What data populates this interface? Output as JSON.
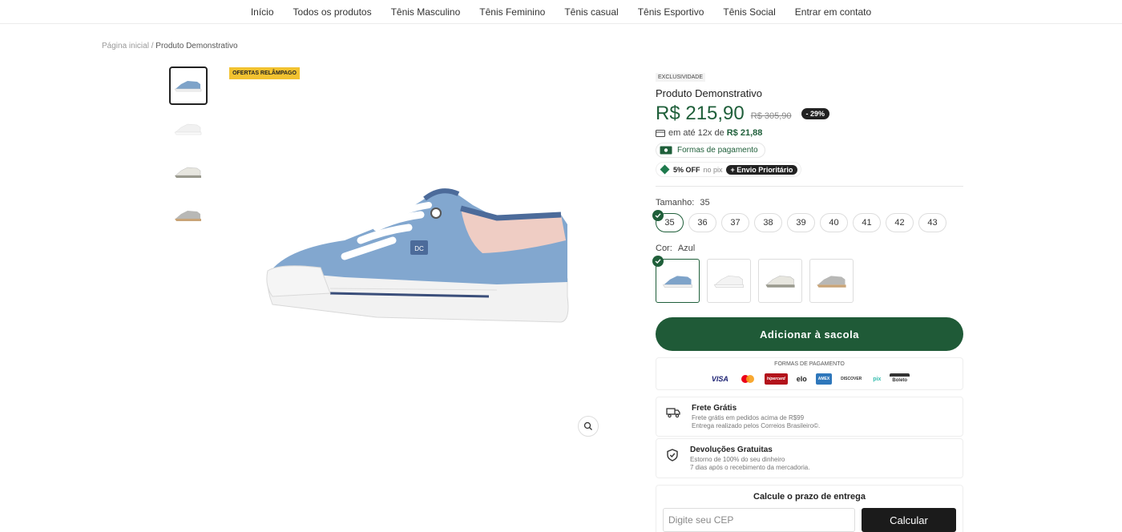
{
  "nav": [
    "Início",
    "Todos os produtos",
    "Tênis Masculino",
    "Tênis Feminino",
    "Tênis casual",
    "Tênis Esportivo",
    "Tênis Social",
    "Entrar em contato"
  ],
  "breadcrumb": {
    "home": "Página inicial",
    "sep": "/",
    "current": "Produto Demonstrativo"
  },
  "badge_flash": "OFERTAS RELÂMPAGO",
  "product": {
    "exclusive": "EXCLUSIVIDADE",
    "name": "Produto Demonstrativo",
    "price": "R$ 215,90",
    "old_price": "R$ 305,90",
    "discount": "- 29%",
    "installment_text": "em até 12x de",
    "installment_value": "R$ 21,88",
    "payment_methods_label": "Formas de pagamento",
    "pix_off": "5% OFF",
    "pix_text": "no pix",
    "priority": "+ Envio Prioritário"
  },
  "size": {
    "label": "Tamanho:",
    "selected": "35",
    "options": [
      "35",
      "36",
      "37",
      "38",
      "39",
      "40",
      "41",
      "42",
      "43"
    ]
  },
  "color": {
    "label": "Cor:",
    "selected": "Azul"
  },
  "add_to_bag": "Adicionar à sacola",
  "payments": {
    "title": "FORMAS DE PAGAMENTO",
    "logos": [
      "VISA",
      "mastercard",
      "hipercard",
      "elo",
      "AMEX",
      "DISCOVER",
      "pix",
      "Boleto"
    ]
  },
  "features": [
    {
      "title": "Frete Grátis",
      "line1": "Frete grátis em pedidos acima de R$99",
      "line2": "Entrega realizado pelos Correios Brasileiro©."
    },
    {
      "title": "Devoluções Gratuitas",
      "line1": "Estorno de 100% do seu dinheiro",
      "line2": "7 dias após o recebimento da mercadoria."
    }
  ],
  "cep": {
    "title": "Calcule o prazo de entrega",
    "placeholder": "Digite seu CEP",
    "button": "Calcular"
  },
  "colors_theme": {
    "primary": "#1f5a37",
    "badge": "#f2c230"
  }
}
